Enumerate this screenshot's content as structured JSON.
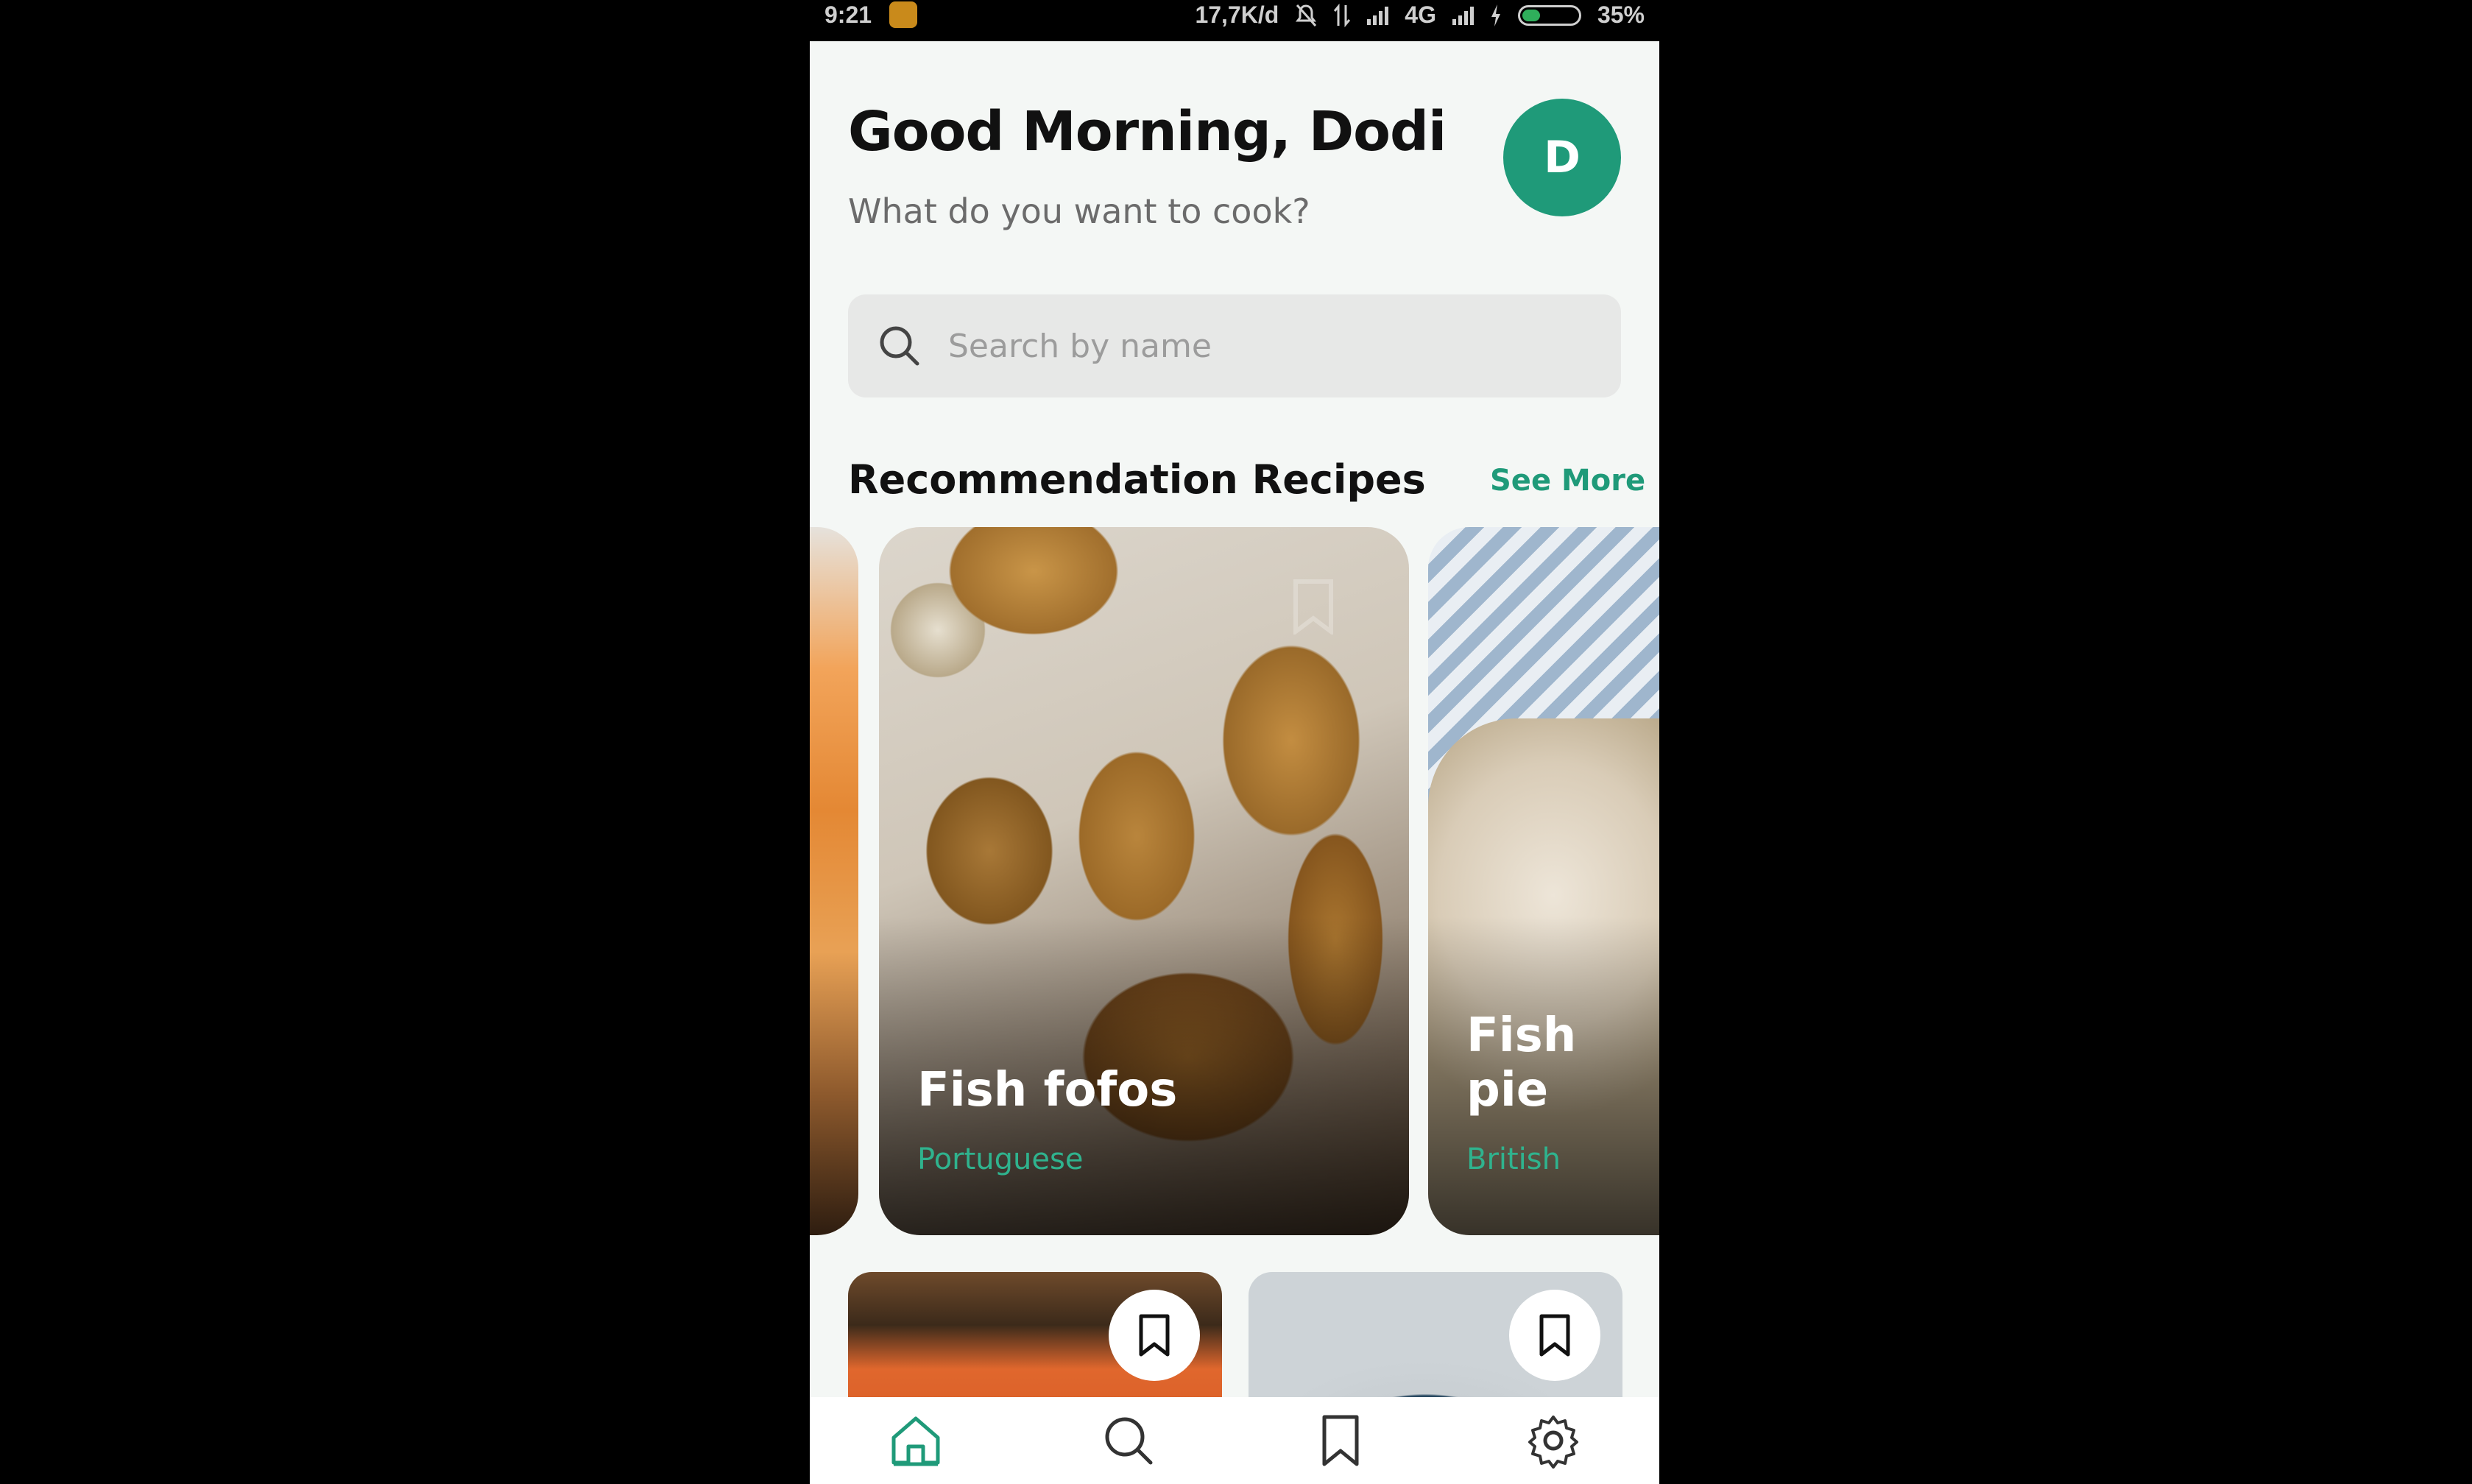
{
  "status_bar": {
    "time": "9:21",
    "network_speed": "17,7K/d",
    "network_type": "4G",
    "battery": "35%",
    "battery_level": 0.35
  },
  "header": {
    "greeting": "Good Morning, Dodi",
    "subtitle": "What do you want to cook?",
    "avatar_initial": "D",
    "avatar_color": "#1f9a79"
  },
  "search": {
    "placeholder": "Search by name",
    "icon": "search-icon"
  },
  "recommendations": {
    "title": "Recommendation Recipes",
    "see_more": "See More",
    "cards": [
      {
        "title": "Fish fofos",
        "cuisine": "Portuguese"
      },
      {
        "title": "Fish pie",
        "cuisine": "British"
      }
    ]
  },
  "bottom_nav": {
    "items": [
      {
        "name": "home",
        "icon": "home-icon",
        "active": true
      },
      {
        "name": "search",
        "icon": "search-icon",
        "active": false
      },
      {
        "name": "saved",
        "icon": "bookmark-icon",
        "active": false
      },
      {
        "name": "settings",
        "icon": "gear-icon",
        "active": false
      }
    ],
    "active_color": "#1f9a79"
  },
  "colors": {
    "accent": "#1f9a79",
    "cuisine_text": "#2fb38e",
    "background": "#f4f7f5"
  }
}
